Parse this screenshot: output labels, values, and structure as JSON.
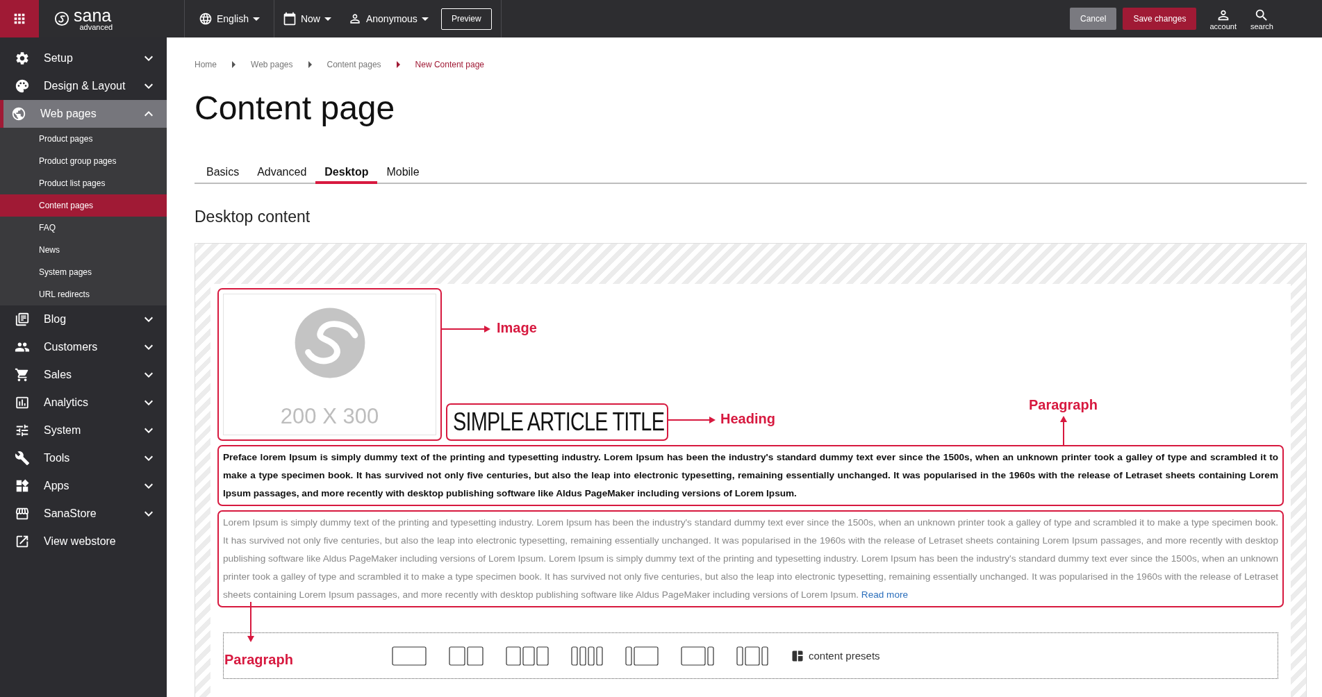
{
  "topbar": {
    "logo": "sana",
    "logo_sub": "advanced",
    "selectors": [
      {
        "label": "English",
        "kind": "language"
      },
      {
        "label": "Now",
        "kind": "date"
      },
      {
        "label": "Anonymous",
        "kind": "user"
      }
    ],
    "preview": "Preview",
    "cancel": "Cancel",
    "save": "Save changes",
    "actions": [
      {
        "label": "account",
        "kind": "account"
      },
      {
        "label": "search",
        "kind": "search"
      }
    ]
  },
  "sidebar": {
    "items": [
      {
        "label": "Setup",
        "kind": "setup",
        "expanded": false
      },
      {
        "label": "Design & Layout",
        "kind": "design",
        "expanded": false
      },
      {
        "label": "Web pages",
        "kind": "web",
        "expanded": true,
        "children": [
          {
            "label": "Product pages",
            "selected": false
          },
          {
            "label": "Product group pages",
            "selected": false
          },
          {
            "label": "Product list pages",
            "selected": false
          },
          {
            "label": "Content pages",
            "selected": true
          },
          {
            "label": "FAQ",
            "selected": false
          },
          {
            "label": "News",
            "selected": false
          },
          {
            "label": "System pages",
            "selected": false
          },
          {
            "label": "URL redirects",
            "selected": false
          }
        ]
      },
      {
        "label": "Blog",
        "kind": "blog",
        "expanded": false
      },
      {
        "label": "Customers",
        "kind": "customers",
        "expanded": false
      },
      {
        "label": "Sales",
        "kind": "sales",
        "expanded": false
      },
      {
        "label": "Analytics",
        "kind": "analytics",
        "expanded": false
      },
      {
        "label": "System",
        "kind": "system",
        "expanded": false
      },
      {
        "label": "Tools",
        "kind": "tools",
        "expanded": false
      },
      {
        "label": "Apps",
        "kind": "apps",
        "expanded": false
      },
      {
        "label": "SanaStore",
        "kind": "store",
        "expanded": false
      },
      {
        "label": "View webstore",
        "kind": "external"
      }
    ]
  },
  "breadcrumb": [
    {
      "label": "Home",
      "current": false
    },
    {
      "label": "Web pages",
      "current": false
    },
    {
      "label": "Content pages",
      "current": false
    },
    {
      "label": "New Content page",
      "current": true
    }
  ],
  "title": "Content page",
  "tabs": [
    {
      "label": "Basics",
      "selected": false
    },
    {
      "label": "Advanced",
      "selected": false
    },
    {
      "label": "Desktop",
      "selected": true
    },
    {
      "label": "Mobile",
      "selected": false
    }
  ],
  "section_title": "Desktop content",
  "canvas": {
    "image": {
      "placeholder": "200 X 300"
    },
    "heading": "SIMPLE ARTICLE TITLE",
    "paragraphs": [
      {
        "kind": "bold",
        "text": "Preface lorem Ipsum is simply dummy text of the printing and typesetting industry. Lorem Ipsum has been the industry's standard dummy text ever since the 1500s, when an unknown printer took a galley of type and scrambled it to make a type specimen book. It has survived not only five centuries, but also the leap into electronic typesetting, remaining essentially unchanged. It was popularised in the 1960s with the release of Letraset sheets containing Lorem Ipsum passages, and more recently with desktop publishing software like Aldus PageMaker including versions of Lorem Ipsum."
      },
      {
        "kind": "light",
        "text": "Lorem Ipsum is simply dummy text of the printing and typesetting industry. Lorem Ipsum has been the industry's standard dummy text ever since the 1500s, when an unknown printer took a galley of type and scrambled it to make a type specimen book. It has survived not only five centuries, but also the leap into electronic typesetting, remaining essentially unchanged. It was popularised in the 1960s with the release of Letraset sheets containing Lorem Ipsum passages, and more recently with desktop publishing software like Aldus PageMaker including versions of Lorem Ipsum. Lorem Ipsum is simply dummy text of the printing and typesetting industry. Lorem Ipsum has been the industry's standard dummy text ever since the 1500s, when an unknown printer took a galley of type and scrambled it to make a type specimen book. It has survived not only five centuries, but also the leap into electronic typesetting, remaining essentially unchanged. It was popularised in the 1960s with the release of Letraset sheets containing Lorem Ipsum passages, and more recently with desktop publishing software like Aldus PageMaker including versions of Lorem Ipsum.",
        "link": "Read more"
      }
    ],
    "presets_label": "content presets",
    "annotations": [
      {
        "label": "Image",
        "kind": "image"
      },
      {
        "label": "Heading",
        "kind": "heading"
      },
      {
        "label": "Paragraph",
        "kind": "above"
      },
      {
        "label": "Paragraph",
        "kind": "below"
      }
    ]
  }
}
